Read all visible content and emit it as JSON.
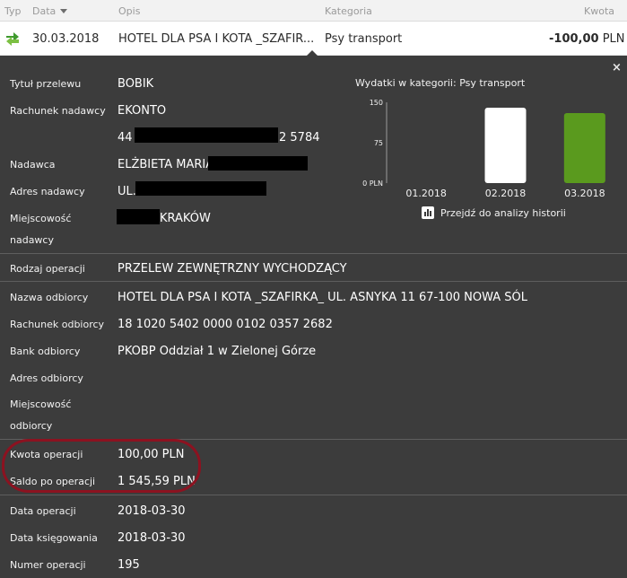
{
  "header": {
    "col_type": "Typ",
    "col_date": "Data",
    "col_desc": "Opis",
    "col_category": "Kategoria",
    "col_amount": "Kwota"
  },
  "transaction": {
    "icon": "transfer-arrows-icon",
    "date": "30.03.2018",
    "description": "HOTEL DLA PSA I KOTA _SZAFIR...",
    "category": "Psy transport",
    "amount": "-100,00",
    "currency": "PLN"
  },
  "details": {
    "close_symbol": "×",
    "title_label": "Tytuł przelewu",
    "title_value": "BOBIK",
    "sender_account_label": "Rachunek nadawcy",
    "sender_account_name": "EKONTO",
    "sender_account_prefix": "44",
    "sender_account_suffix": "2 5784",
    "sender_label": "Nadawca",
    "sender_value": "ELŻBIETA MARIA",
    "sender_address_label": "Adres nadawcy",
    "sender_address_value": "UL.",
    "sender_city_label_1": "Miejscowość",
    "sender_city_label_2": "nadawcy",
    "sender_city_value": "KRAKÓW",
    "operation_type_label": "Rodzaj operacji",
    "operation_type_value": "PRZELEW ZEWNĘTRZNY WYCHODZĄCY",
    "recipient_name_label": "Nazwa odbiorcy",
    "recipient_name_value": "HOTEL DLA PSA I KOTA _SZAFIRKA_ UL. ASNYKA 11 67-100 NOWA SÓL",
    "recipient_account_label": "Rachunek odbiorcy",
    "recipient_account_value": "18 1020 5402 0000 0102 0357 2682",
    "recipient_bank_label": "Bank odbiorcy",
    "recipient_bank_value": "PKOBP Oddział 1 w Zielonej Górze",
    "recipient_address_label": "Adres odbiorcy",
    "recipient_city_label_1": "Miejscowość",
    "recipient_city_label_2": "odbiorcy",
    "amount_label": "Kwota operacji",
    "amount_value": "100,00 PLN",
    "balance_label": "Saldo po operacji",
    "balance_value": "1 545,59 PLN",
    "op_date_label": "Data operacji",
    "op_date_value": "2018-03-30",
    "booking_date_label": "Data księgowania",
    "booking_date_value": "2018-03-30",
    "op_number_label": "Numer operacji",
    "op_number_value": "195"
  },
  "history": {
    "title": "Wydatki w kategorii:  Psy transport",
    "link_label": "Przejdź do analizy historii",
    "link_icon": "bar-chart-icon"
  },
  "chart_data": {
    "type": "bar",
    "categories": [
      "01.2018",
      "02.2018",
      "03.2018"
    ],
    "values": [
      0,
      140,
      130
    ],
    "ylim": [
      0,
      150
    ],
    "yticks": [
      0,
      75,
      150
    ],
    "ytick_labels": [
      "0 PLN",
      "75",
      "150"
    ],
    "bar_colors": [
      "#ffffff",
      "#ffffff",
      "#5a9a1e"
    ],
    "grid": false,
    "legend": "none"
  }
}
